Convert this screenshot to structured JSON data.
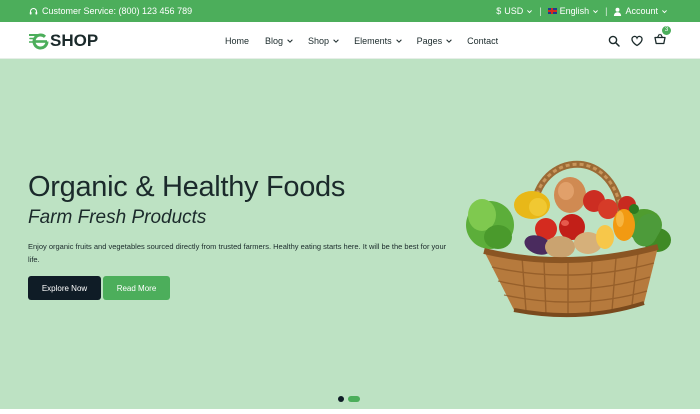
{
  "topbar": {
    "service_text": "Customer Service: (800) 123 456 789",
    "currency": "USD",
    "currency_symbol": "$",
    "language": "English",
    "account": "Account",
    "separator": "|"
  },
  "header": {
    "logo_letter": "e",
    "logo_text": "SHOP",
    "nav": [
      {
        "label": "Home"
      },
      {
        "label": "Blog"
      },
      {
        "label": "Shop"
      },
      {
        "label": "Elements"
      },
      {
        "label": "Pages"
      },
      {
        "label": "Contact"
      }
    ],
    "cart_count": "3"
  },
  "hero": {
    "title": "Organic & Healthy Foods",
    "subtitle": "Farm Fresh Products",
    "description": "Enjoy organic fruits and vegetables sourced directly from trusted farmers. Healthy eating starts here. It will be the best for your life.",
    "primary_button": "Explore Now",
    "secondary_button": "Read More",
    "slides_total": 2,
    "active_slide": 2
  },
  "colors": {
    "brand_green": "#4cae5b",
    "hero_bg": "#bde2c3",
    "dark": "#0f1c26",
    "text": "#1b2a2b"
  }
}
